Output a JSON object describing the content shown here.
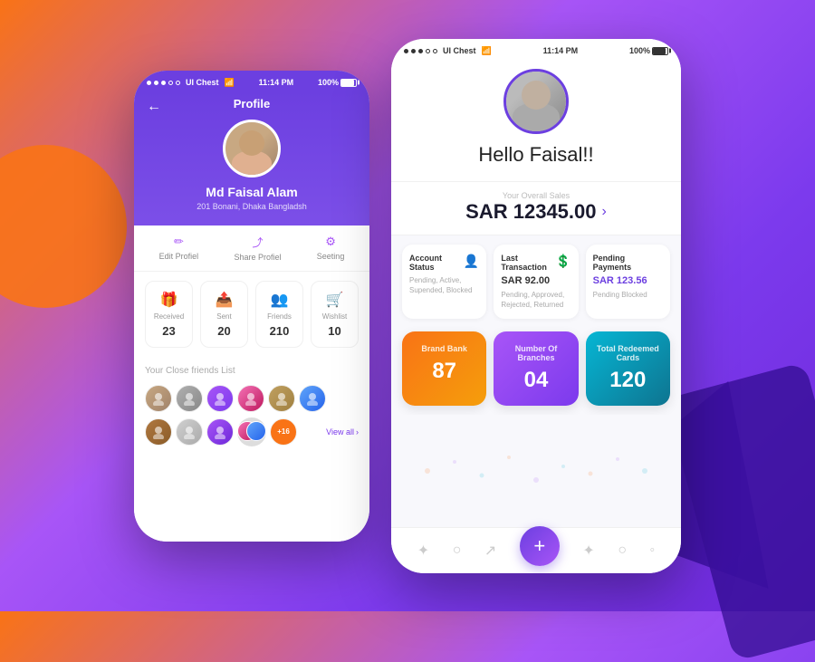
{
  "background": {
    "gradient_start": "#f97316",
    "gradient_end": "#6d28d9"
  },
  "left_phone": {
    "status_bar": {
      "dots": "●●●○○",
      "app_name": "UI Chest",
      "wifi": "WiFi",
      "time": "11:14 PM",
      "battery": "100%"
    },
    "header": {
      "back_icon": "←",
      "title": "Profile",
      "avatar_alt": "Md Faisal Alam avatar"
    },
    "user": {
      "name": "Md Faisal Alam",
      "address": "201 Bonani, Dhaka Bangladsh"
    },
    "actions": [
      {
        "icon": "✏️",
        "label": "Edit Profiel"
      },
      {
        "icon": "↗",
        "label": "Share Profiel"
      },
      {
        "icon": "⚙",
        "label": "Seeting"
      }
    ],
    "stats": [
      {
        "icon": "🎁",
        "label": "Received",
        "value": "23",
        "color": "#a855f7"
      },
      {
        "icon": "📤",
        "label": "Sent",
        "value": "20",
        "color": "#f97316"
      },
      {
        "icon": "👥",
        "label": "Friends",
        "value": "210",
        "color": "#a855f7"
      },
      {
        "icon": "🛒",
        "label": "Wishlist",
        "value": "10",
        "color": "#a855f7"
      }
    ],
    "friends": {
      "section_title": "Your Close friends List",
      "view_all": "View all",
      "count_badge": "+16"
    }
  },
  "right_phone": {
    "status_bar": {
      "dots": "●●●○○",
      "app_name": "UI Chest",
      "wifi": "WiFi",
      "time": "11:14 PM",
      "battery": "100%"
    },
    "greeting": "Hello Faisal!!",
    "sales": {
      "label": "Your Overall Sales",
      "amount": "SAR 12345.00",
      "chevron": "›"
    },
    "info_cards": [
      {
        "title": "Account Status",
        "icon": "👤",
        "description": "Pending, Active, Supended, Blocked"
      },
      {
        "title": "Last Transaction",
        "icon": "💲",
        "amount": "SAR 92.00",
        "description": "Pending, Approved, Rejected, Returned"
      },
      {
        "title": "Pending Payments",
        "icon": "",
        "amount": "SAR 123.56",
        "amount_color": "purple"
      }
    ],
    "color_cards": [
      {
        "title": "Brand Bank",
        "value": "87",
        "color": "orange"
      },
      {
        "title": "Number Of Branches",
        "value": "04",
        "color": "purple"
      },
      {
        "title": "Total Redeemed Cards",
        "value": "120",
        "color": "teal"
      }
    ],
    "bottom_nav": {
      "icons": [
        "♟",
        "○",
        "↗",
        "+",
        "✦",
        "○",
        "◦"
      ]
    }
  }
}
